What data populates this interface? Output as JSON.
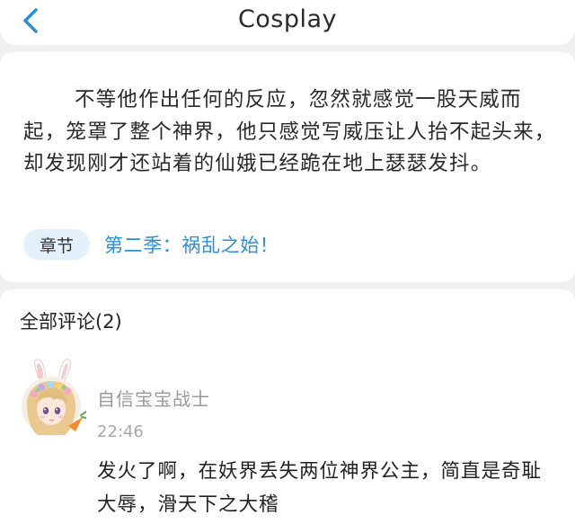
{
  "header": {
    "title": "Cosplay",
    "back_icon": "chevron-left-icon",
    "accent_color": "#2b8fd6"
  },
  "story": {
    "text": "不等他作出任何的反应，忽然就感觉一股天威而起，笼罩了整个神界，他只感觉写威压让人抬不起头来，却发现刚才还站着的仙娥已经跪在地上瑟瑟发抖。",
    "chapter_tag": "章节",
    "chapter_link": "第二季：祸乱之始！"
  },
  "comments": {
    "title": "全部评论(2)",
    "items": [
      {
        "username": "自信宝宝战士",
        "time": "22:46",
        "text": "发火了啊，在妖界丢失两位神界公主，简直是奇耻大辱，滑天下之大稽",
        "avatar_icon": "bunny-girl-avatar"
      }
    ]
  }
}
